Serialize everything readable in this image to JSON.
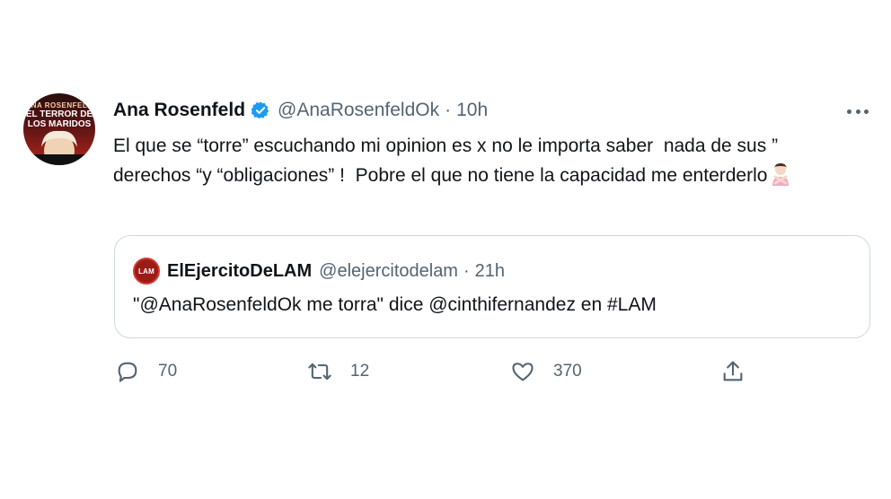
{
  "author": {
    "display_name": "Ana Rosenfeld",
    "handle": "@AnaRosenfeldOk",
    "separator": "·",
    "time": "10h",
    "avatar_text": [
      "ANA ROSENFELD",
      "EL TERROR DE",
      "LOS MARIDOS"
    ]
  },
  "tweet": {
    "text": "El que se “torre” escuchando mi opinion es x no le importa saber  nada de sus ” derechos “y “obligaciones” !  Pobre el que no tiene la capacidad me enterderlo",
    "emoji": "woman-gesturing-no"
  },
  "quoted": {
    "display_name": "ElEjercitoDeLAM",
    "handle": "@elejercitodelam",
    "separator": "·",
    "time": "21h",
    "avatar_text": "LAM",
    "text": "\"@AnaRosenfeldOk me torra\" dice @cinthifernandez en #LAM"
  },
  "actions": {
    "reply_count": "70",
    "retweet_count": "12",
    "like_count": "370"
  },
  "colors": {
    "text": "#0f1419",
    "secondary": "#536471",
    "verified": "#1d9bf0",
    "border": "#cfd9de"
  }
}
